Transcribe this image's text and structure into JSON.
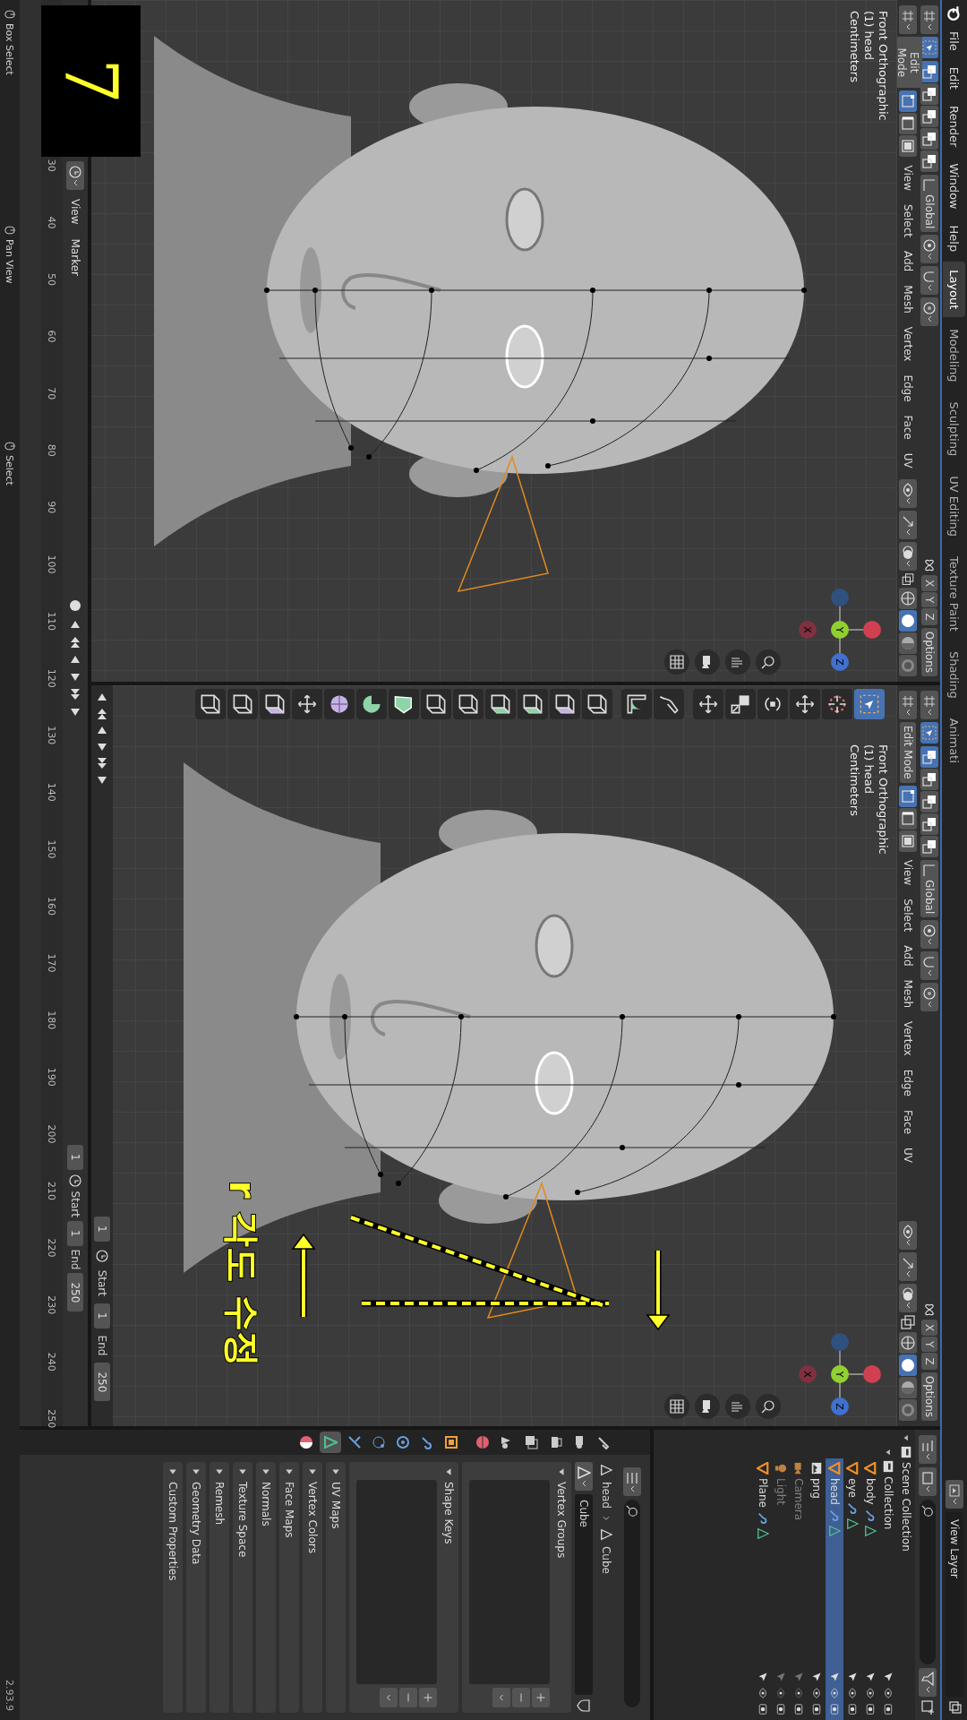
{
  "top_bar": {
    "menus": [
      "File",
      "Edit",
      "Render",
      "Window",
      "Help"
    ],
    "workspaces": [
      {
        "label": "Layout",
        "selected": true
      },
      {
        "label": "Modeling",
        "selected": false
      },
      {
        "label": "Sculpting",
        "selected": false
      },
      {
        "label": "UV Editing",
        "selected": false
      },
      {
        "label": "Texture Paint",
        "selected": false
      },
      {
        "label": "Shading",
        "selected": false
      },
      {
        "label": "Animati",
        "selected": false
      }
    ],
    "view_layer": "View Layer"
  },
  "viewports": [
    {
      "mode": "Edit Mode",
      "set_modes": [
        {
          "selected": true
        },
        {
          "selected": false
        },
        {
          "selected": false
        },
        {
          "selected": false
        },
        {
          "selected": false
        }
      ],
      "select_modes": [
        {
          "kind": "vertex",
          "selected": true
        },
        {
          "kind": "edge",
          "selected": false
        },
        {
          "kind": "face",
          "selected": false
        }
      ],
      "menus": [
        "View",
        "Select",
        "Add",
        "Mesh",
        "Vertex",
        "Edge",
        "Face",
        "UV"
      ],
      "orientation": "Global",
      "mirror_axes": [
        "X",
        "Y",
        "Z"
      ],
      "options": "Options",
      "shading": [
        {
          "kind": "wireframe",
          "selected": false
        },
        {
          "kind": "solid",
          "selected": true
        },
        {
          "kind": "material",
          "selected": false
        },
        {
          "kind": "rendered",
          "selected": false
        }
      ],
      "overlay_text": [
        "Front Orthographic",
        "(1) head",
        "Centimeters"
      ],
      "gizmo": {
        "x": "X",
        "y": "Y",
        "z": "Z"
      }
    },
    {
      "mode": "Edit Mode",
      "set_modes": [
        {
          "selected": true
        },
        {
          "selected": false
        },
        {
          "selected": false
        },
        {
          "selected": false
        },
        {
          "selected": false
        }
      ],
      "select_modes": [
        {
          "kind": "vertex",
          "selected": true
        },
        {
          "kind": "edge",
          "selected": false
        },
        {
          "kind": "face",
          "selected": false
        }
      ],
      "menus": [
        "View",
        "Select",
        "Add",
        "Mesh",
        "Vertex",
        "Edge",
        "Face",
        "UV"
      ],
      "orientation": "Global",
      "mirror_axes": [
        "X",
        "Y",
        "Z"
      ],
      "options": "Options",
      "shading": [
        {
          "kind": "wireframe",
          "selected": false
        },
        {
          "kind": "solid",
          "selected": true
        },
        {
          "kind": "material",
          "selected": false
        },
        {
          "kind": "rendered",
          "selected": false
        }
      ],
      "overlay_text": [
        "Front Orthographic",
        "(1) head",
        "Centimeters"
      ],
      "gizmo": {
        "x": "X",
        "y": "Y",
        "z": "Z"
      },
      "toolbar": [
        {
          "kind": "select",
          "selected": true
        },
        {
          "kind": "cursor",
          "selected": false
        },
        {
          "kind": "move",
          "selected": false
        },
        {
          "kind": "rotate",
          "selected": false
        },
        {
          "kind": "scale",
          "selected": false
        },
        {
          "kind": "transform",
          "selected": false
        },
        {
          "kind": "annotate",
          "selected": false
        },
        {
          "kind": "measure",
          "selected": false
        },
        {
          "kind": "add-cube",
          "selected": false
        },
        {
          "kind": "extrude",
          "selected": false
        },
        {
          "kind": "inset",
          "selected": false
        },
        {
          "kind": "bevel",
          "selected": false
        },
        {
          "kind": "loop-cut",
          "selected": false
        },
        {
          "kind": "knife",
          "selected": false
        },
        {
          "kind": "poly-build",
          "selected": false
        },
        {
          "kind": "spin",
          "selected": false
        },
        {
          "kind": "smooth",
          "selected": false
        },
        {
          "kind": "edge-slide",
          "selected": false
        },
        {
          "kind": "shrink",
          "selected": false
        },
        {
          "kind": "shear",
          "selected": false
        },
        {
          "kind": "rip",
          "selected": false
        }
      ],
      "playback": {
        "frame": "1",
        "start_label": "Start",
        "start": "1",
        "end_label": "End",
        "end": "250"
      },
      "annotation": {
        "note": "r 각도 수정"
      }
    }
  ],
  "timeline": {
    "menus": [
      "View",
      "Marker"
    ],
    "frame": "1",
    "start_label": "Start",
    "start": "1",
    "end_label": "End",
    "end": "250",
    "ruler": [
      "30",
      "40",
      "50",
      "60",
      "70",
      "80",
      "90",
      "100",
      "110",
      "120",
      "130",
      "140",
      "150",
      "160",
      "170",
      "180",
      "190",
      "200",
      "210",
      "220",
      "230",
      "240",
      "250"
    ]
  },
  "outliner": {
    "items": [
      {
        "label": "Scene Collection",
        "kind": "scene",
        "selected": false,
        "dimmed": false,
        "children": [
          {
            "label": "Collection",
            "kind": "collection",
            "selected": false,
            "dimmed": false,
            "children": [
              {
                "label": "body",
                "kind": "mesh",
                "selected": false,
                "dimmed": false
              },
              {
                "label": "eye",
                "kind": "mesh",
                "selected": false,
                "dimmed": false
              },
              {
                "label": "head",
                "kind": "mesh",
                "selected": true,
                "dimmed": false
              },
              {
                "label": "png",
                "kind": "image",
                "selected": false,
                "dimmed": false
              },
              {
                "label": "Camera",
                "kind": "camera",
                "selected": false,
                "dimmed": true
              },
              {
                "label": "Light",
                "kind": "light",
                "selected": false,
                "dimmed": true
              },
              {
                "label": "Plane",
                "kind": "mesh",
                "selected": false,
                "dimmed": false
              }
            ]
          }
        ]
      }
    ]
  },
  "properties": {
    "tabs": [
      {
        "kind": "tool",
        "selected": false
      },
      {
        "kind": "render",
        "selected": false
      },
      {
        "kind": "output",
        "selected": false
      },
      {
        "kind": "view-layer",
        "selected": false
      },
      {
        "kind": "scene",
        "selected": false
      },
      {
        "kind": "world",
        "selected": false
      },
      {
        "kind": "object",
        "selected": false
      },
      {
        "kind": "modifiers",
        "selected": false
      },
      {
        "kind": "particles",
        "selected": false
      },
      {
        "kind": "physics",
        "selected": false
      },
      {
        "kind": "constraints",
        "selected": false
      },
      {
        "kind": "data",
        "selected": true
      },
      {
        "kind": "material",
        "selected": false
      }
    ],
    "breadcrumb": [
      "head",
      "Cube"
    ],
    "mesh_name": "Cube",
    "panels": [
      {
        "label": "Vertex Groups",
        "kind": "list",
        "expanded": true
      },
      {
        "label": "Shape Keys",
        "kind": "list",
        "expanded": true
      },
      {
        "label": "UV Maps",
        "kind": "plain",
        "expanded": false
      },
      {
        "label": "Vertex Colors",
        "kind": "plain",
        "expanded": false
      },
      {
        "label": "Face Maps",
        "kind": "plain",
        "expanded": false
      },
      {
        "label": "Normals",
        "kind": "plain",
        "expanded": false
      },
      {
        "label": "Texture Space",
        "kind": "plain",
        "expanded": false
      },
      {
        "label": "Remesh",
        "kind": "plain",
        "expanded": false
      },
      {
        "label": "Geometry Data",
        "kind": "plain",
        "expanded": false
      },
      {
        "label": "Custom Properties",
        "kind": "plain",
        "expanded": false
      }
    ]
  },
  "status_bar": {
    "hints": [
      "Box Select",
      "Pan View",
      "Select"
    ],
    "version": "2.93.9"
  },
  "step_label": "7"
}
